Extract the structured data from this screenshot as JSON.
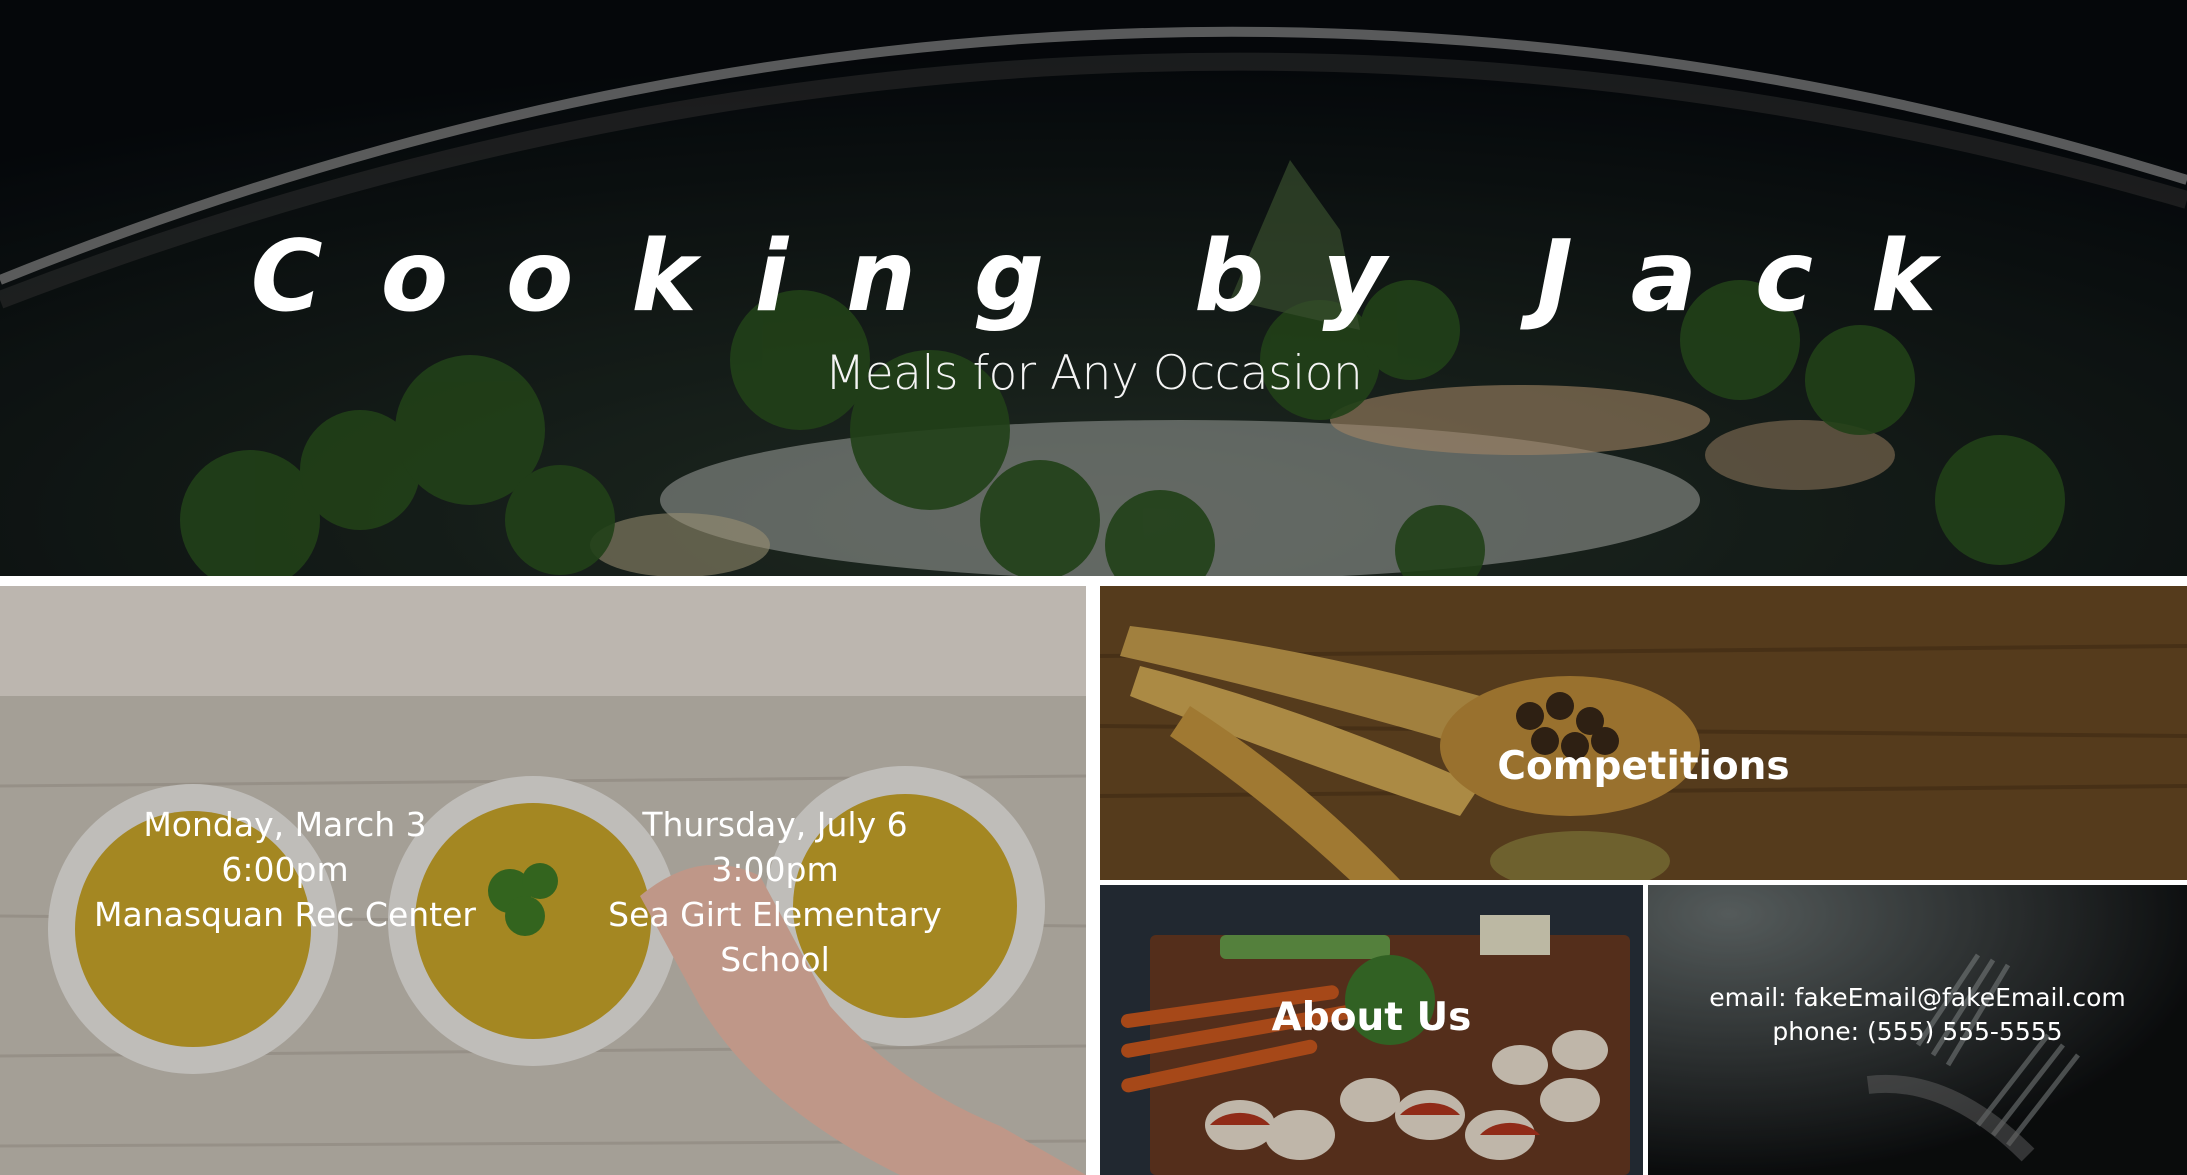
{
  "hero": {
    "title": "Cooking by Jack",
    "subtitle": "Meals for Any Occasion"
  },
  "events": [
    {
      "day": "Monday, March 3",
      "time": "6:00pm",
      "location": "Manasquan Rec Center"
    },
    {
      "day": "Thursday, July 6",
      "time": "3:00pm",
      "location": "Sea Girt Elementary School"
    }
  ],
  "competitions": {
    "heading": "Competitions"
  },
  "about": {
    "heading": "About Us"
  },
  "contact": {
    "email": "email: fakeEmail@fakeEmail.com",
    "phone": "phone: (555) 555-5555"
  }
}
